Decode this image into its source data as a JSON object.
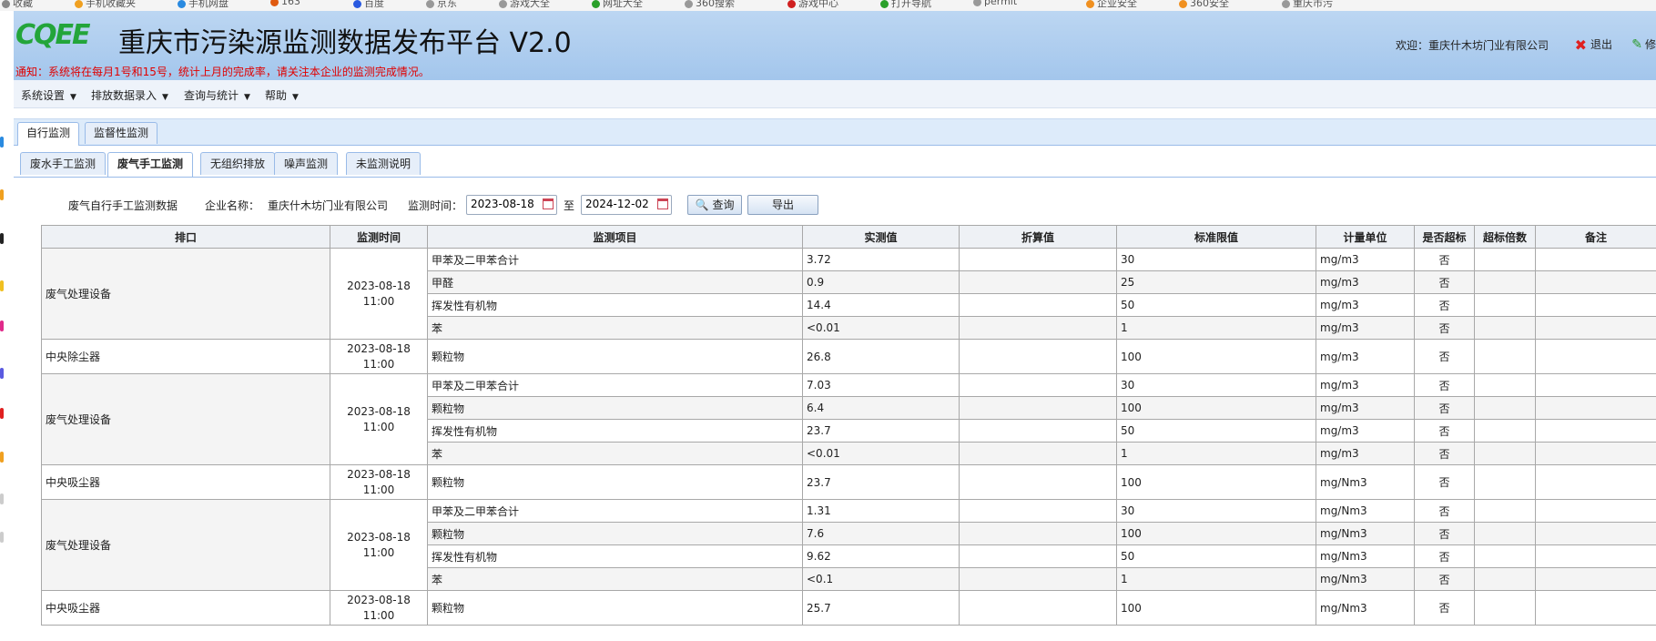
{
  "bookmarks": [
    {
      "label": "收藏",
      "color": "#888888"
    },
    {
      "label": "手机收藏夹",
      "color": "#f0a020"
    },
    {
      "label": "手机网盘",
      "color": "#2a8ae0"
    },
    {
      "label": "163",
      "color": "#e05a10"
    },
    {
      "label": "百度",
      "color": "#2a5ae0"
    },
    {
      "label": "京东",
      "color": "#999999"
    },
    {
      "label": "游戏大全",
      "color": "#999999"
    },
    {
      "label": "网址大全",
      "color": "#2aa02a"
    },
    {
      "label": "360搜索",
      "color": "#999999"
    },
    {
      "label": "游戏中心",
      "color": "#d02020"
    },
    {
      "label": "打开导航",
      "color": "#2aa02a"
    },
    {
      "label": "permit",
      "color": "#999999"
    },
    {
      "label": "企业安全",
      "color": "#f09020"
    },
    {
      "label": "360安全",
      "color": "#f09020"
    },
    {
      "label": "重庆市污",
      "color": "#999999"
    }
  ],
  "header": {
    "logo_text": "CQEE",
    "title": "重庆市污染源监测数据发布平台 V2.0",
    "notice": "通知：系统将在每月1号和15号，统计上月的完成率，请关注本企业的监测完成情况。",
    "welcome": "欢迎：重庆什木坊门业有限公司",
    "logout": "退出",
    "modify": "修"
  },
  "menu": [
    {
      "label": "系统设置"
    },
    {
      "label": "排放数据录入"
    },
    {
      "label": "查询与统计"
    },
    {
      "label": "帮助"
    }
  ],
  "tabs_main": [
    {
      "label": "自行监测",
      "active": true
    },
    {
      "label": "监督性监测",
      "active": false
    }
  ],
  "tabs_sub": [
    {
      "label": "废水手工监测",
      "active": false
    },
    {
      "label": "废气手工监测",
      "active": true
    },
    {
      "label": "无组织排放",
      "active": false
    },
    {
      "label": "噪声监测",
      "active": false
    },
    {
      "label": "未监测说明",
      "active": false
    }
  ],
  "filter": {
    "section_title": "废气自行手工监测数据",
    "company_label": "企业名称：",
    "company_name": "重庆什木坊门业有限公司",
    "time_label": "监测时间：",
    "start_date": "2023-08-18",
    "to_label": "至",
    "end_date": "2024-12-02",
    "query_button": "查询",
    "export_button": "导出"
  },
  "table": {
    "columns": [
      "排口",
      "监测时间",
      "监测项目",
      "实测值",
      "折算值",
      "标准限值",
      "计量单位",
      "是否超标",
      "超标倍数",
      "备注"
    ],
    "groups": [
      {
        "outlet": "废气处理设备",
        "date": "2023-08-18",
        "time": "11:00",
        "rows": [
          {
            "item": "甲苯及二甲苯合计",
            "measured": "3.72",
            "converted": "",
            "limit": "30",
            "unit": "mg/m3",
            "exceed": "否",
            "multiple": "",
            "note": ""
          },
          {
            "item": "甲醛",
            "measured": "0.9",
            "converted": "",
            "limit": "25",
            "unit": "mg/m3",
            "exceed": "否",
            "multiple": "",
            "note": ""
          },
          {
            "item": "挥发性有机物",
            "measured": "14.4",
            "converted": "",
            "limit": "50",
            "unit": "mg/m3",
            "exceed": "否",
            "multiple": "",
            "note": ""
          },
          {
            "item": "苯",
            "measured": "<0.01",
            "converted": "",
            "limit": "1",
            "unit": "mg/m3",
            "exceed": "否",
            "multiple": "",
            "note": ""
          }
        ]
      },
      {
        "outlet": "中央除尘器",
        "date": "2023-08-18",
        "time": "11:00",
        "rows": [
          {
            "item": "颗粒物",
            "measured": "26.8",
            "converted": "",
            "limit": "100",
            "unit": "mg/m3",
            "exceed": "否",
            "multiple": "",
            "note": ""
          }
        ]
      },
      {
        "outlet": "废气处理设备",
        "date": "2023-08-18",
        "time": "11:00",
        "rows": [
          {
            "item": "甲苯及二甲苯合计",
            "measured": "7.03",
            "converted": "",
            "limit": "30",
            "unit": "mg/m3",
            "exceed": "否",
            "multiple": "",
            "note": ""
          },
          {
            "item": "颗粒物",
            "measured": "6.4",
            "converted": "",
            "limit": "100",
            "unit": "mg/m3",
            "exceed": "否",
            "multiple": "",
            "note": ""
          },
          {
            "item": "挥发性有机物",
            "measured": "23.7",
            "converted": "",
            "limit": "50",
            "unit": "mg/m3",
            "exceed": "否",
            "multiple": "",
            "note": ""
          },
          {
            "item": "苯",
            "measured": "<0.01",
            "converted": "",
            "limit": "1",
            "unit": "mg/m3",
            "exceed": "否",
            "multiple": "",
            "note": ""
          }
        ]
      },
      {
        "outlet": "中央吸尘器",
        "date": "2023-08-18",
        "time": "11:00",
        "rows": [
          {
            "item": "颗粒物",
            "measured": "23.7",
            "converted": "",
            "limit": "100",
            "unit": "mg/Nm3",
            "exceed": "否",
            "multiple": "",
            "note": ""
          }
        ]
      },
      {
        "outlet": "废气处理设备",
        "date": "2023-08-18",
        "time": "11:00",
        "rows": [
          {
            "item": "甲苯及二甲苯合计",
            "measured": "1.31",
            "converted": "",
            "limit": "30",
            "unit": "mg/Nm3",
            "exceed": "否",
            "multiple": "",
            "note": ""
          },
          {
            "item": "颗粒物",
            "measured": "7.6",
            "converted": "",
            "limit": "100",
            "unit": "mg/Nm3",
            "exceed": "否",
            "multiple": "",
            "note": ""
          },
          {
            "item": "挥发性有机物",
            "measured": "9.62",
            "converted": "",
            "limit": "50",
            "unit": "mg/Nm3",
            "exceed": "否",
            "multiple": "",
            "note": ""
          },
          {
            "item": "苯",
            "measured": "<0.1",
            "converted": "",
            "limit": "1",
            "unit": "mg/Nm3",
            "exceed": "否",
            "multiple": "",
            "note": ""
          }
        ]
      },
      {
        "outlet": "中央吸尘器",
        "date": "2023-08-18",
        "time": "11:00",
        "rows": [
          {
            "item": "颗粒物",
            "measured": "25.7",
            "converted": "",
            "limit": "100",
            "unit": "mg/Nm3",
            "exceed": "否",
            "multiple": "",
            "note": ""
          }
        ]
      }
    ]
  }
}
